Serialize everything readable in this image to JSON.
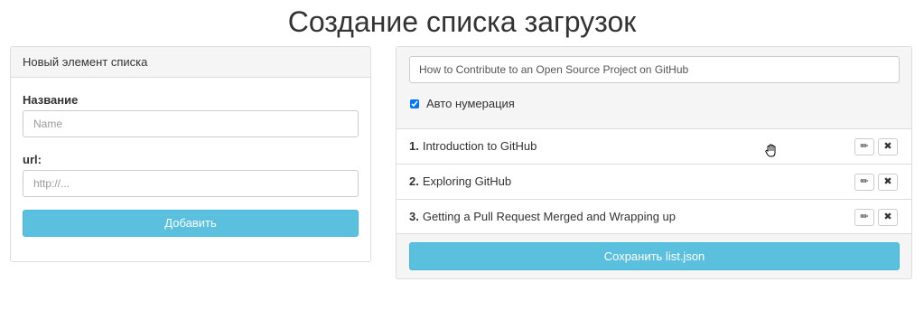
{
  "page": {
    "title": "Создание списка загрузок"
  },
  "new_item_panel": {
    "heading": "Новый элемент списка",
    "name_label": "Название",
    "name_placeholder": "Name",
    "url_label": "url:",
    "url_placeholder": "http://...",
    "add_button": "Добавить"
  },
  "list_panel": {
    "list_title_value": "How to Contribute to an Open Source Project on GitHub",
    "auto_numbering_label": "Авто нумерация",
    "auto_numbering_checked": true,
    "items": [
      {
        "num": "1.",
        "title": "Introduction to GitHub"
      },
      {
        "num": "2.",
        "title": "Exploring GitHub"
      },
      {
        "num": "3.",
        "title": "Getting a Pull Request Merged and Wrapping up"
      }
    ],
    "edit_icon": "✏",
    "delete_icon": "✖",
    "save_button": "Сохранить list.json"
  },
  "icons": {
    "edit": "pencil-icon",
    "delete": "close-icon",
    "cursor": "hand-cursor-icon"
  },
  "colors": {
    "accent": "#5bc0de",
    "panel_heading_bg": "#f5f5f5",
    "border": "#dddddd"
  }
}
